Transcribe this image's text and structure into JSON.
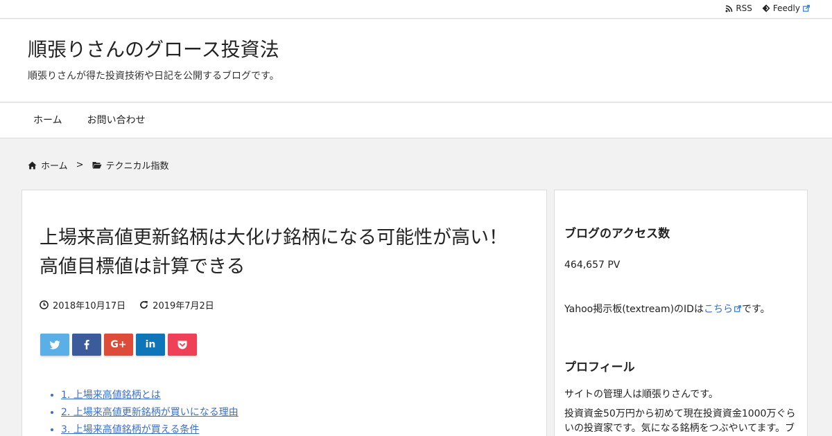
{
  "topbar": {
    "rss_label": "RSS",
    "feedly_label": "Feedly"
  },
  "header": {
    "title": "順張りさんのグロース投資法",
    "description": "順張りさんが得た投資技術や日記を公開するブログです。"
  },
  "nav": {
    "items": [
      "ホーム",
      "お問い合わせ"
    ]
  },
  "breadcrumb": {
    "home": "ホーム",
    "separator": ">",
    "category": "テクニカル指数"
  },
  "post": {
    "title": "上場来高値更新銘柄は大化け銘柄になる可能性が高い！高値目標値は計算できる",
    "published": "2018年10月17日",
    "updated": "2019年7月2日",
    "share": [
      {
        "name": "twitter",
        "color": "#5aafe6"
      },
      {
        "name": "facebook",
        "color": "#3b5b9a"
      },
      {
        "name": "google-plus",
        "color": "#dd4b39",
        "label": "G+"
      },
      {
        "name": "linkedin",
        "color": "#0e76b8",
        "label": "in"
      },
      {
        "name": "pocket",
        "color": "#ee4056"
      }
    ],
    "toc": [
      "1. 上場来高値銘柄とは",
      "2. 上場来高値更新銘柄が買いになる理由",
      "3. 上場来高値銘柄が買える条件"
    ]
  },
  "sidebar": {
    "access_title": "ブログのアクセス数",
    "pv": "464,657 PV",
    "yahoo_prefix": "Yahoo掲示板(textream)のIDは",
    "yahoo_link": "こちら",
    "yahoo_suffix": "です。",
    "profile_title": "プロフィール",
    "profile_line1": "サイトの管理人は順張りさんです。",
    "profile_line2": "投資資金50万円から初めて現在投資資金1000万ぐらいの投資家です。気になる銘柄をつぶやいてます。ブ"
  }
}
